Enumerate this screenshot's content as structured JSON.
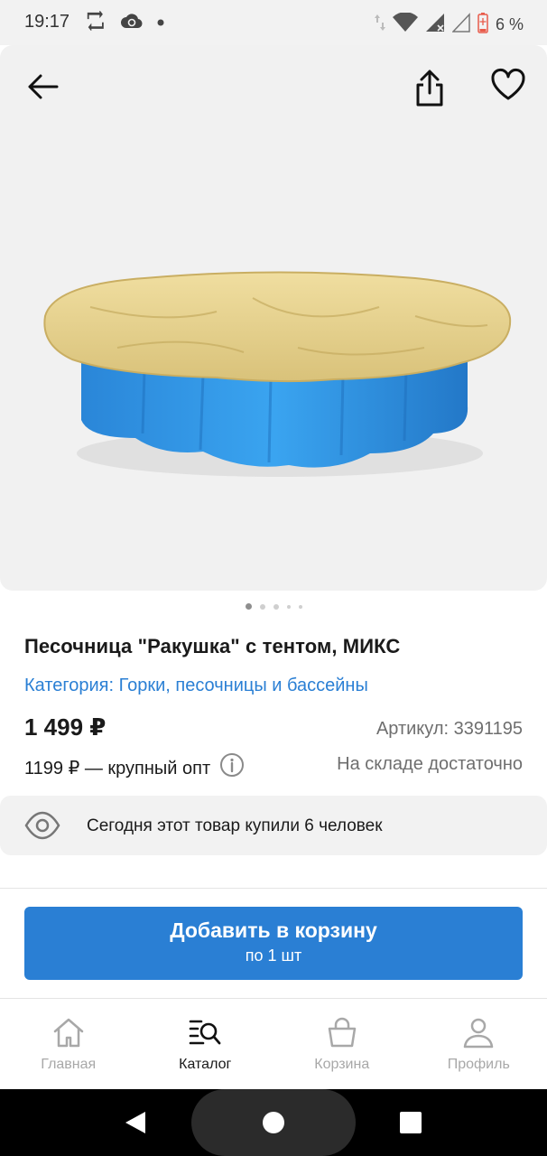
{
  "status_bar": {
    "time": "19:17",
    "battery_text": "6 %",
    "icons": [
      "repeat-icon",
      "cloud-sync-icon",
      "dot-icon",
      "data-arrows-icon",
      "wifi-icon",
      "signal-icon",
      "signal-empty-icon",
      "battery-icon"
    ]
  },
  "header": {
    "icons": [
      "back-arrow-icon",
      "share-icon",
      "heart-icon"
    ]
  },
  "gallery": {
    "image_alt": "sandbox-shell-with-cover",
    "dots_count": 5,
    "active_index": 0
  },
  "product": {
    "title": "Песочница \"Ракушка\" с тентом, МИКС",
    "category": "Категория: Горки, песочницы и бассейны",
    "price": "1 499 ₽",
    "sku": "Артикул: 3391195",
    "wholesale": "1199 ₽ — крупный опт",
    "stock": "На складе достаточно",
    "bought_today": "Сегодня этот товар купили 6 человек"
  },
  "cart_button": {
    "label": "Добавить в корзину",
    "sublabel": "по 1 шт"
  },
  "tabs": [
    {
      "label": "Главная",
      "icon": "home-icon",
      "active": false
    },
    {
      "label": "Каталог",
      "icon": "catalog-search-icon",
      "active": true
    },
    {
      "label": "Корзина",
      "icon": "basket-icon",
      "active": false
    },
    {
      "label": "Профиль",
      "icon": "profile-icon",
      "active": false
    }
  ],
  "colors": {
    "accent": "#2a7fd4",
    "background_gray": "#f1f1f1",
    "inactive_tab": "#a8a8a8"
  }
}
